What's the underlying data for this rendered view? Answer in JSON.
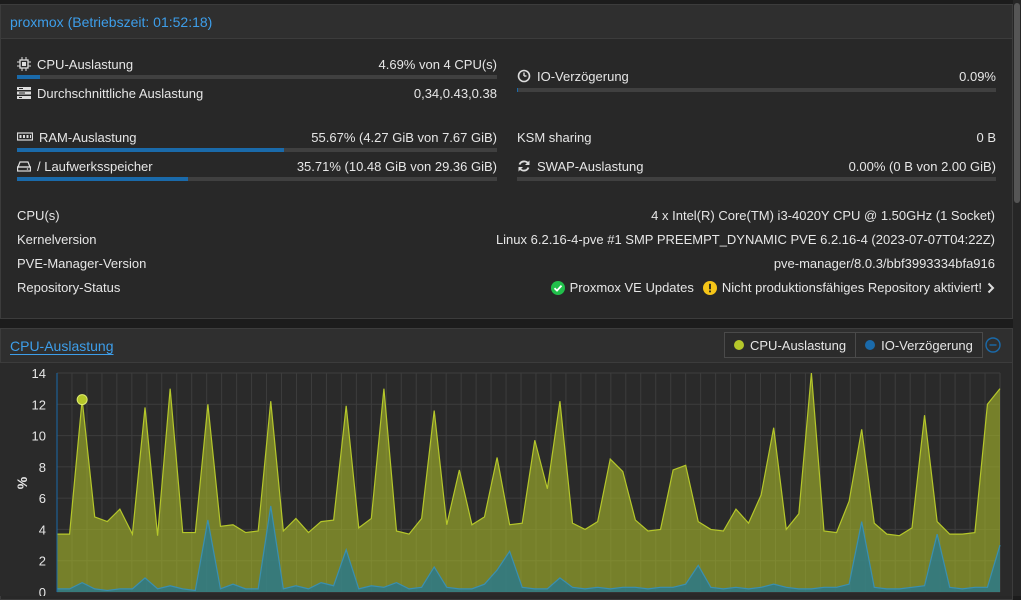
{
  "status_panel": {
    "title": "proxmox (Betriebszeit: 01:52:18)",
    "cpu_usage": {
      "label": "CPU-Auslastung",
      "value": "4.69% von 4 CPU(s)",
      "fraction": 0.047
    },
    "load_avg": {
      "label": "Durchschnittliche Auslastung",
      "value": "0,34,0.43,0.38"
    },
    "io_delay": {
      "label": "IO-Verzögerung",
      "value": "0.09%",
      "fraction": 0.001
    },
    "ram_usage": {
      "label": "RAM-Auslastung",
      "value": "55.67% (4.27 GiB von 7.67 GiB)",
      "fraction": 0.5567
    },
    "ksm": {
      "label": "KSM sharing",
      "value": "0 B"
    },
    "disk": {
      "label": "/ Laufwerksspeicher",
      "value": "35.71% (10.48 GiB von 29.36 GiB)",
      "fraction": 0.3571
    },
    "swap": {
      "label": "SWAP-Auslastung",
      "value": "0.00% (0 B von 2.00 GiB)",
      "fraction": 0.0
    },
    "cpus": {
      "label": "CPU(s)",
      "value": "4 x Intel(R) Core(TM) i3-4020Y CPU @ 1.50GHz (1 Socket)"
    },
    "kernel": {
      "label": "Kernelversion",
      "value": "Linux 6.2.16-4-pve #1 SMP PREEMPT_DYNAMIC PVE 6.2.16-4 (2023-07-07T04:22Z)"
    },
    "pve": {
      "label": "PVE-Manager-Version",
      "value": "pve-manager/8.0.3/bbf3993334bfa916"
    },
    "repo": {
      "label": "Repository-Status",
      "ok_text": "Proxmox VE Updates",
      "warn_text": "Nicht produktionsfähiges Repository aktiviert!"
    }
  },
  "colors": {
    "accent": "#3d9eea",
    "cpu_series": "#b5c72a",
    "io_series": "#1a6aaa",
    "ok": "#21bf4b",
    "warn": "#f5c518"
  },
  "chart_data": {
    "type": "area",
    "title": "CPU-Auslastung",
    "ylabel": "%",
    "ylim": [
      0,
      14
    ],
    "yticks": [
      0,
      2,
      4,
      6,
      8,
      10,
      12,
      14
    ],
    "series": [
      {
        "name": "CPU-Auslastung",
        "values": [
          3.7,
          3.7,
          12.3,
          4.8,
          4.5,
          5.3,
          3.7,
          11.8,
          3.6,
          13.0,
          3.8,
          3.8,
          12.0,
          4.2,
          4.3,
          3.8,
          3.9,
          12.2,
          3.9,
          4.7,
          3.8,
          4.5,
          4.6,
          11.9,
          4.1,
          4.7,
          13.0,
          3.9,
          3.7,
          4.7,
          11.6,
          4.3,
          7.8,
          4.3,
          4.8,
          8.6,
          4.3,
          4.4,
          9.7,
          6.6,
          12.2,
          4.4,
          4.0,
          4.5,
          8.5,
          7.7,
          4.6,
          3.9,
          4.0,
          7.8,
          8.1,
          4.5,
          4.0,
          3.9,
          5.3,
          4.4,
          6.2,
          10.5,
          4.0,
          5.0,
          14.0,
          3.9,
          3.8,
          5.8,
          10.4,
          4.4,
          3.7,
          3.6,
          4.1,
          11.3,
          4.5,
          3.7,
          3.7,
          3.8,
          12.0,
          13.0
        ]
      },
      {
        "name": "IO-Verzögerung",
        "values": [
          0.2,
          0.2,
          0.6,
          0.2,
          0.1,
          0.2,
          0.2,
          0.9,
          0.2,
          0.4,
          0.2,
          0.1,
          4.6,
          0.2,
          0.5,
          0.2,
          0.2,
          5.5,
          0.2,
          0.4,
          0.2,
          0.6,
          0.4,
          2.7,
          0.2,
          0.4,
          0.3,
          0.6,
          0.2,
          0.3,
          1.6,
          0.3,
          0.2,
          0.2,
          0.5,
          1.4,
          2.6,
          0.3,
          0.2,
          0.2,
          0.9,
          0.3,
          0.2,
          0.3,
          0.2,
          0.3,
          0.3,
          0.2,
          0.3,
          0.3,
          0.5,
          1.7,
          0.3,
          0.2,
          0.3,
          0.2,
          0.3,
          0.5,
          0.3,
          0.2,
          0.2,
          0.3,
          0.3,
          0.5,
          4.5,
          0.3,
          0.2,
          0.2,
          0.3,
          0.4,
          3.7,
          0.3,
          0.2,
          0.3,
          0.3,
          3.0
        ]
      }
    ],
    "highlight_point": {
      "index": 2,
      "value": 12.3
    },
    "grid": true,
    "legend": "top-right"
  },
  "cpu_panel": {
    "title": "CPU-Auslastung",
    "legend_cpu": "CPU-Auslastung",
    "legend_io": "IO-Verzögerung"
  }
}
